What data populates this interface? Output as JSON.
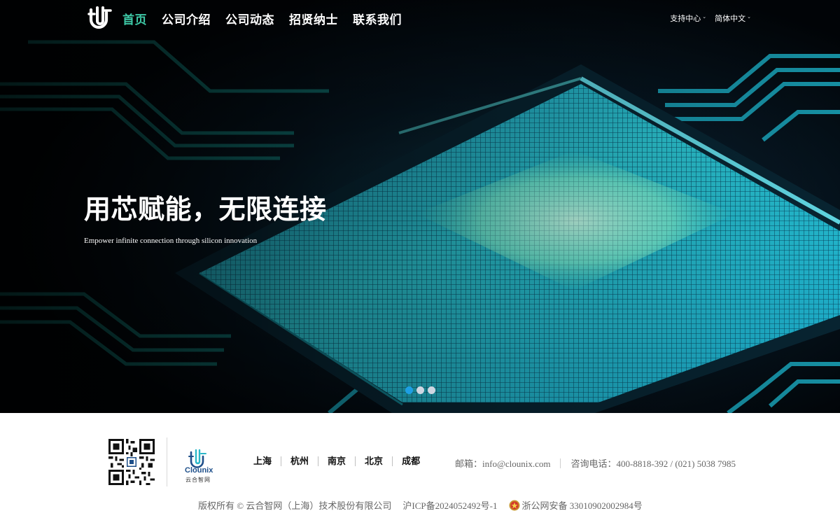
{
  "nav": {
    "items": [
      {
        "label": "首页",
        "active": true
      },
      {
        "label": "公司介绍"
      },
      {
        "label": "公司动态"
      },
      {
        "label": "招贤纳士"
      },
      {
        "label": "联系我们"
      }
    ]
  },
  "utility": {
    "support": "支持中心",
    "language": "简体中文"
  },
  "hero": {
    "title": "用芯赋能，无限连接",
    "subtitle": "Empower infinite connection through silicon innovation",
    "slides": 3,
    "active_slide": 1
  },
  "footer": {
    "brand_name": "Clounix",
    "brand_cn": "云合智网",
    "cities": [
      "上海",
      "杭州",
      "南京",
      "北京",
      "成都"
    ],
    "email": "邮箱：info@clounix.com",
    "phone": "咨询电话：400-8818-392 / (021) 5038 7985",
    "copyright": "版权所有 © 云合智网（上海）技术股份有限公司",
    "icp": "沪ICP备2024052492号-1",
    "police": "浙公网安备 33010902002984号"
  },
  "colors": {
    "nav_active": "#3ec9a7",
    "dot_active": "#1e9fe4",
    "dot_inactive": "#cfd6e2",
    "brand_blue": "#1e4f8a"
  },
  "icons": {
    "logo": "clounix-logo-icon",
    "qr": "qr-code-icon",
    "police": "police-badge-icon",
    "chevron": "chevron-down-icon"
  }
}
